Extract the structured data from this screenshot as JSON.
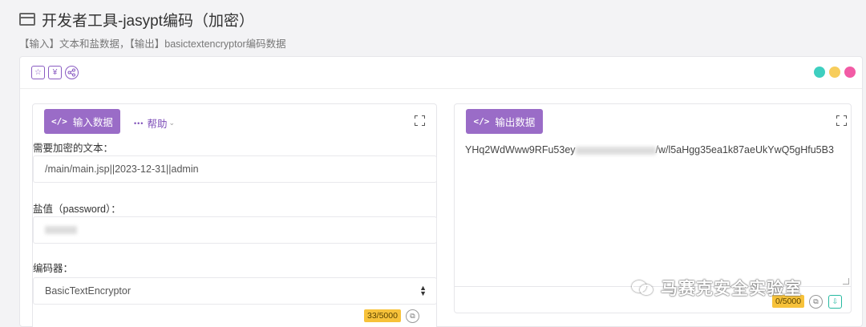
{
  "header": {
    "title": "开发者工具-jasypt编码（加密）",
    "subtitle": "【输入】文本和盐数据，【输出】basictextencryptor编码数据"
  },
  "toolbar": {
    "icons": [
      "star-icon",
      "yen-icon",
      "share-icon"
    ],
    "yen_glyph": "¥",
    "dot_colors": [
      "#3ecfc0",
      "#f7cd5c",
      "#f25ba5"
    ]
  },
  "input_panel": {
    "tab_label": "输入数据",
    "tab_code": "</>",
    "help_label": "帮助",
    "fields": {
      "text_label": "需要加密的文本：",
      "text_value": "/main/main.jsp||2023-12-31||admin",
      "salt_label": "盐值（password）：",
      "encoder_label": "编码器：",
      "encoder_value": "BasicTextEncryptor"
    },
    "char_count": "33/5000"
  },
  "output_panel": {
    "tab_label": "输出数据",
    "tab_code": "</>",
    "output_start": "YHq2WdWww9RFu53ey",
    "output_end": "/w/l5aHgg35ea1k87aeUkYwQ5gHfu5B3",
    "char_count": "0/5000"
  },
  "watermark": {
    "text": "马赛克安全实验室"
  },
  "colors": {
    "accent": "#9a6cc7",
    "badge": "#f7c23a"
  }
}
